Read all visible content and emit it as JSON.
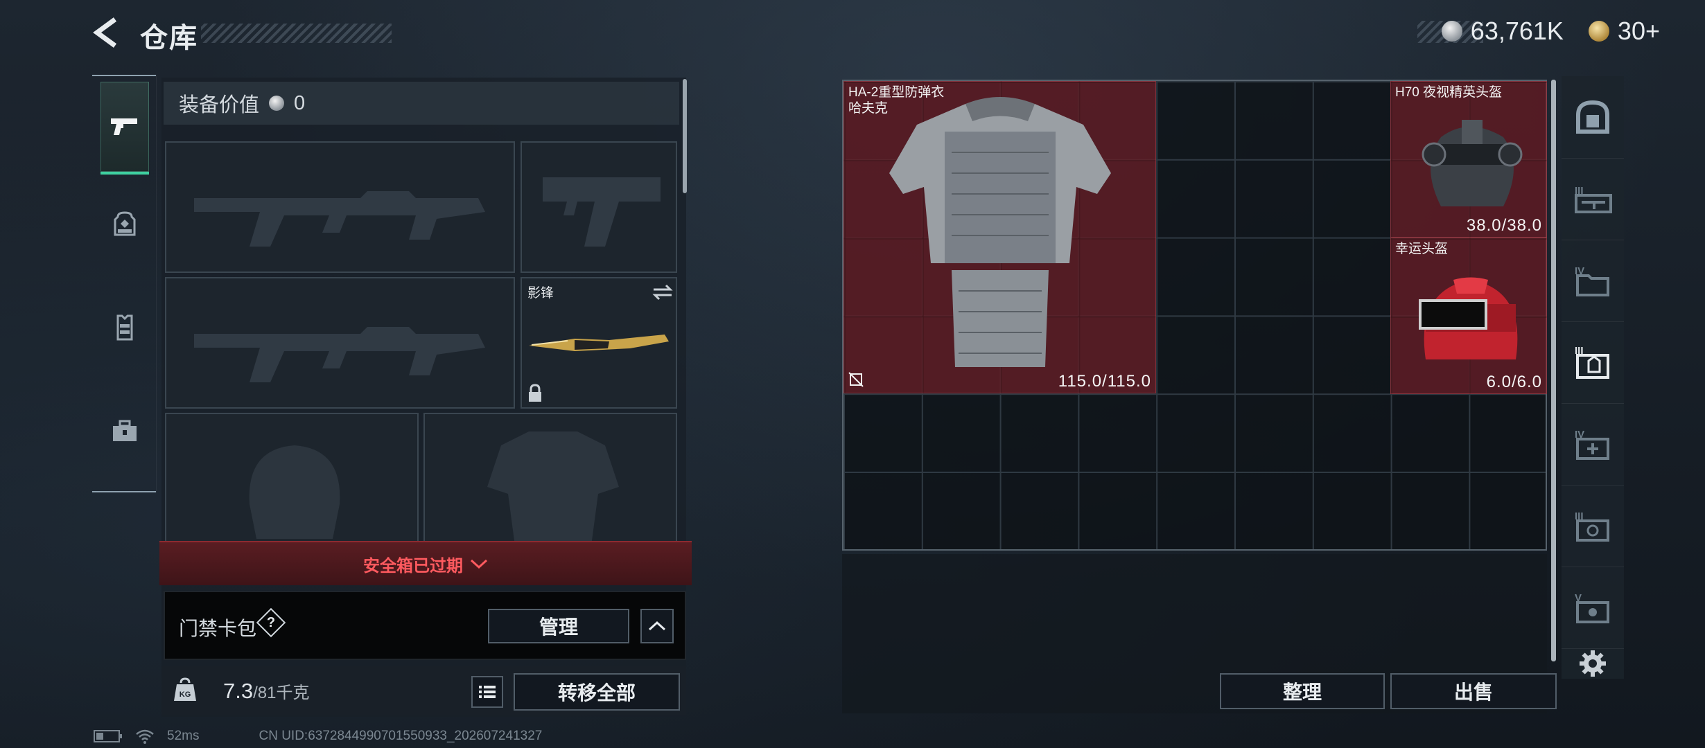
{
  "header": {
    "title": "仓库",
    "silver_amount": "63,761K",
    "gold_amount": "30+"
  },
  "left_tabs": [
    {
      "icon": "pistol-icon",
      "active": true
    },
    {
      "icon": "backpack-icon",
      "active": false
    },
    {
      "icon": "vest-icon",
      "active": false
    },
    {
      "icon": "briefcase-icon",
      "active": false
    }
  ],
  "loadout": {
    "value_label": "装备价值",
    "value_amount": "0",
    "melee_label": "影锋",
    "expired_text": "安全箱已过期",
    "keycard_label": "门禁卡包",
    "keycard_help": "?",
    "manage_button": "管理",
    "weight_current": "7.3",
    "weight_max": "/81千克",
    "transfer_all_button": "转移全部"
  },
  "inventory": {
    "items": [
      {
        "name": "HA-2重型防弹衣\n哈夫克",
        "durability": "115.0/115.0"
      },
      {
        "name": "H70 夜视精英头盔",
        "durability": "38.0/38.0"
      },
      {
        "name": "幸运头盔",
        "durability": "6.0/6.0"
      }
    ],
    "sort_button": "整理",
    "sell_button": "出售"
  },
  "right_tabs": [
    {
      "icon": "safe-icon"
    },
    {
      "icon": "weapon-case-iii-icon"
    },
    {
      "icon": "folder-iv-icon"
    },
    {
      "icon": "armor-case-iii-icon",
      "active": true
    },
    {
      "icon": "medical-case-iv-icon"
    },
    {
      "icon": "parts-case-iii-icon"
    },
    {
      "icon": "case-v-icon"
    },
    {
      "icon": "gear-icon"
    }
  ],
  "status_bar": {
    "ping": "52ms",
    "uid": "CN UID:6372844990701550933_202607241327"
  },
  "colors": {
    "active_tab": "#3fd0a0",
    "item_bg": "#6e1e28",
    "expired_text": "#ff5a5f"
  }
}
